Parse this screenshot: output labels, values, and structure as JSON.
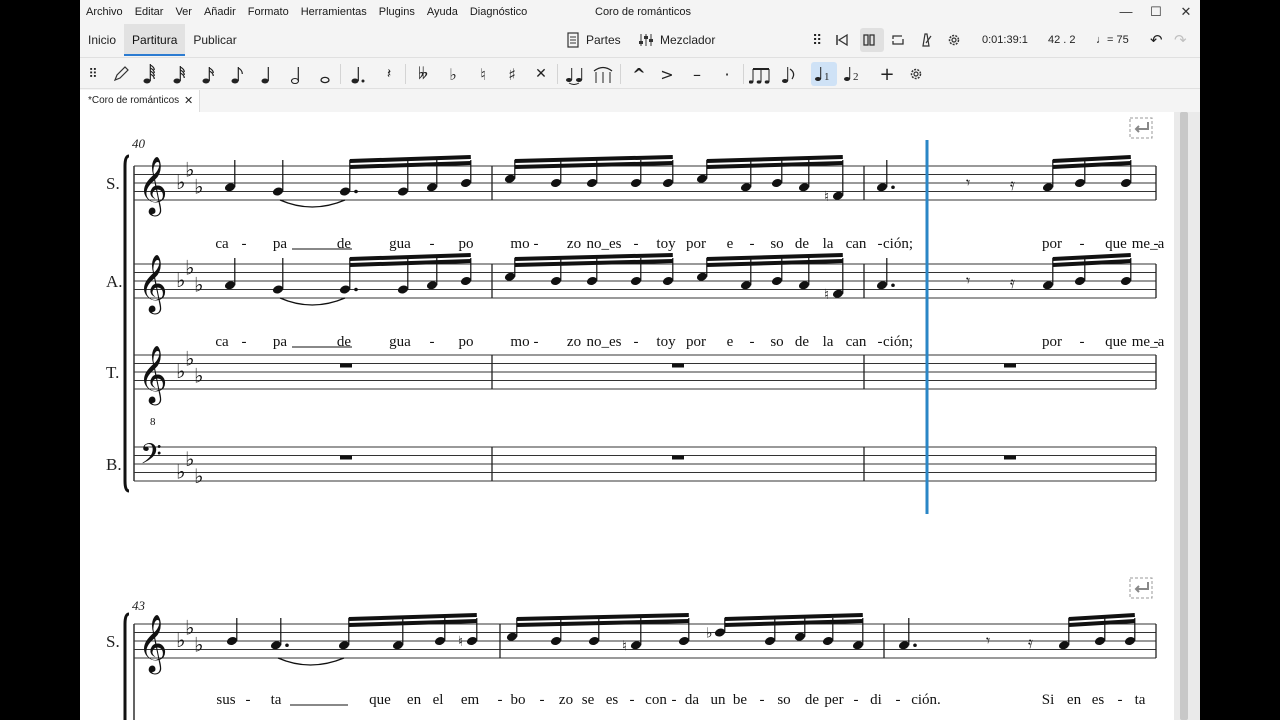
{
  "menu": [
    "Archivo",
    "Editar",
    "Ver",
    "Añadir",
    "Formato",
    "Herramientas",
    "Plugins",
    "Ayuda",
    "Diagnóstico"
  ],
  "window_title": "Coro de románticos",
  "tabs": [
    "Inicio",
    "Partitura",
    "Publicar"
  ],
  "active_tab": "Partitura",
  "toolbar": {
    "parts_label": "Partes",
    "mixer_label": "Mezclador",
    "time": "0:01:39:1",
    "position": "42 . 2",
    "tempo": "= 75"
  },
  "doc_tab": "*Coro de románticos",
  "score": {
    "systems": [
      {
        "measure_number": "40",
        "staves": [
          {
            "name": "S.",
            "clef": "treble",
            "lyrics": [
              "ca",
              "-",
              "pa",
              "de",
              "gua",
              "-",
              "po",
              "mo",
              "-",
              "zo",
              "no_es",
              "-",
              "toy",
              "por",
              "e",
              "-",
              "so",
              "de",
              "la",
              "can",
              "-",
              "ción;",
              "por",
              "-",
              "que",
              "me_a",
              "-"
            ]
          },
          {
            "name": "A.",
            "clef": "treble",
            "lyrics": [
              "ca",
              "-",
              "pa",
              "de",
              "gua",
              "-",
              "po",
              "mo",
              "-",
              "zo",
              "no_es",
              "-",
              "toy",
              "por",
              "e",
              "-",
              "so",
              "de",
              "la",
              "can",
              "-",
              "ción;",
              "por",
              "-",
              "que",
              "me_a",
              "-"
            ]
          },
          {
            "name": "T.",
            "clef": "treble8",
            "lyrics": []
          },
          {
            "name": "B.",
            "clef": "bass",
            "lyrics": []
          }
        ]
      },
      {
        "measure_number": "43",
        "staves": [
          {
            "name": "S.",
            "clef": "treble",
            "lyrics": [
              "sus",
              "-",
              "ta",
              "que",
              "en",
              "el",
              "em",
              "-",
              "bo",
              "-",
              "zo",
              "se",
              "es",
              "-",
              "con",
              "-",
              "da",
              "un",
              "be",
              "-",
              "so",
              "de",
              "per",
              "-",
              "di",
              "-",
              "ción.",
              "Si",
              "en",
              "es",
              "-",
              "ta"
            ]
          }
        ]
      }
    ]
  }
}
